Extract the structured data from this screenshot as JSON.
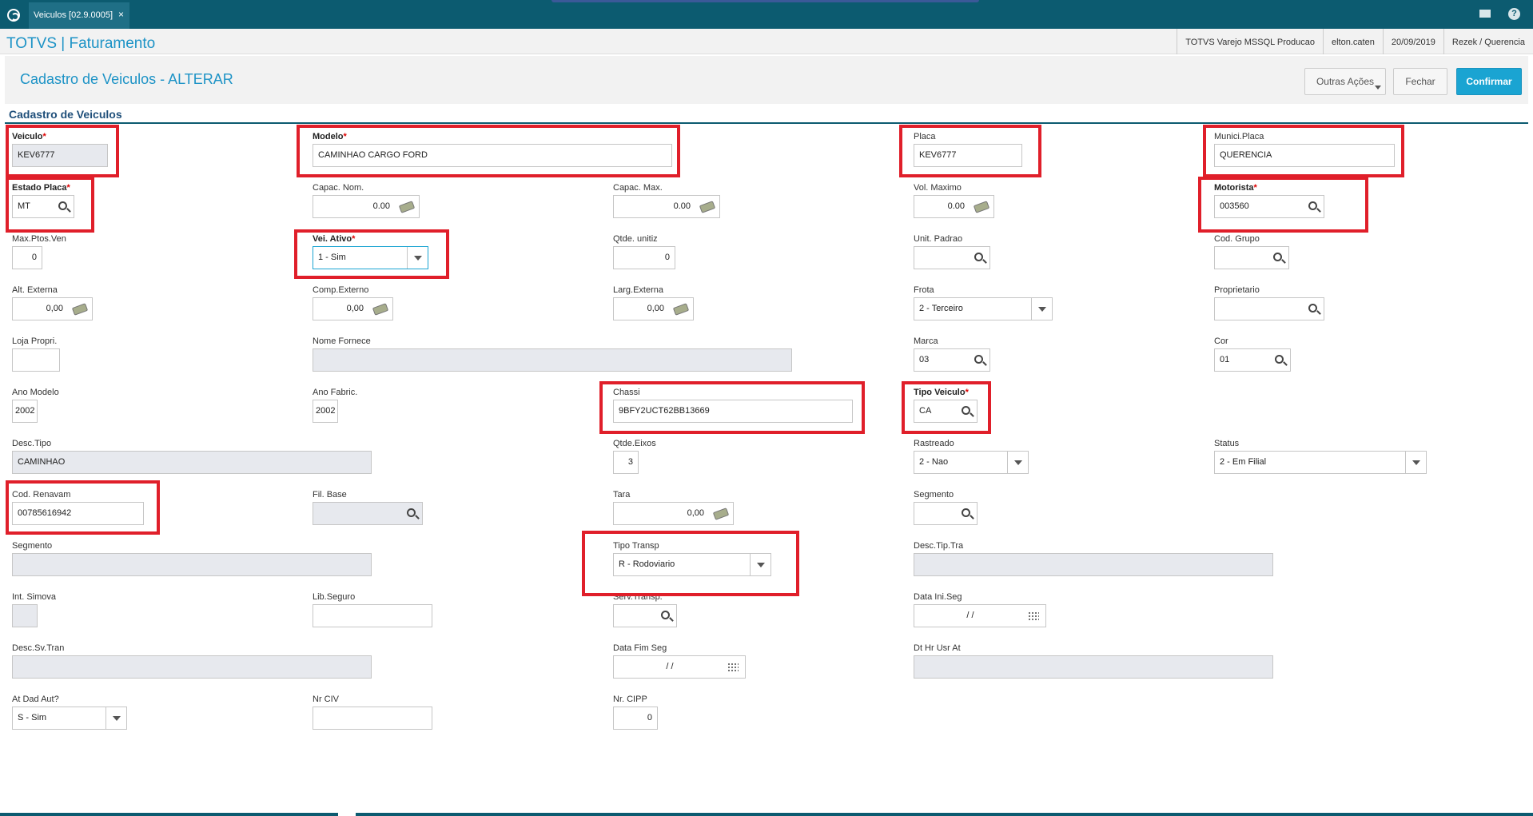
{
  "window": {
    "tab_label": "Veiculos [02.9.0005]",
    "tab_close": "×",
    "help": "?"
  },
  "brand": "TOTVS | Faturamento",
  "info": [
    "TOTVS Varejo MSSQL Producao",
    "elton.caten",
    "20/09/2019",
    "Rezek / Querencia"
  ],
  "page_title": "Cadastro de Veiculos - ALTERAR",
  "buttons": {
    "outras": "Outras Ações",
    "fechar": "Fechar",
    "confirmar": "Confirmar"
  },
  "section_title": "Cadastro de Veiculos",
  "fields": {
    "veiculo": {
      "label": "Veiculo",
      "value": "KEV6777"
    },
    "modelo": {
      "label": "Modelo",
      "value": "CAMINHAO CARGO FORD"
    },
    "placa": {
      "label": "Placa",
      "value": "KEV6777"
    },
    "munici_placa": {
      "label": "Munici.Placa",
      "value": "QUERENCIA"
    },
    "estado_placa": {
      "label": "Estado Placa",
      "value": "MT"
    },
    "capac_nom": {
      "label": "Capac. Nom.",
      "value": "0.00"
    },
    "capac_max": {
      "label": "Capac. Max.",
      "value": "0.00"
    },
    "vol_maximo": {
      "label": "Vol. Maximo",
      "value": "0.00"
    },
    "motorista": {
      "label": "Motorista",
      "value": "003560"
    },
    "max_ptos_ven": {
      "label": "Max.Ptos.Ven",
      "value": "0"
    },
    "vei_ativo": {
      "label": "Vei. Ativo",
      "value": "1 - Sim"
    },
    "qtde_unitiz": {
      "label": "Qtde. unitiz",
      "value": "0"
    },
    "unit_padrao": {
      "label": "Unit. Padrao",
      "value": ""
    },
    "cod_grupo": {
      "label": "Cod. Grupo",
      "value": ""
    },
    "alt_externa": {
      "label": "Alt. Externa",
      "value": "0,00"
    },
    "comp_externo": {
      "label": "Comp.Externo",
      "value": "0,00"
    },
    "larg_externa": {
      "label": "Larg.Externa",
      "value": "0,00"
    },
    "frota": {
      "label": "Frota",
      "value": "2 - Terceiro"
    },
    "proprietario": {
      "label": "Proprietario",
      "value": ""
    },
    "loja_propri": {
      "label": "Loja Propri.",
      "value": ""
    },
    "nome_fornece": {
      "label": "Nome Fornece",
      "value": ""
    },
    "marca": {
      "label": "Marca",
      "value": "03"
    },
    "cor": {
      "label": "Cor",
      "value": "01"
    },
    "ano_modelo": {
      "label": "Ano Modelo",
      "value": "2002"
    },
    "ano_fabric": {
      "label": "Ano Fabric.",
      "value": "2002"
    },
    "chassi": {
      "label": "Chassi",
      "value": "9BFY2UCT62BB13669"
    },
    "tipo_veiculo": {
      "label": "Tipo Veiculo",
      "value": "CA"
    },
    "desc_tipo": {
      "label": "Desc.Tipo",
      "value": "CAMINHAO"
    },
    "qtde_eixos": {
      "label": "Qtde.Eixos",
      "value": "3"
    },
    "rastreado": {
      "label": "Rastreado",
      "value": "2 - Nao"
    },
    "status": {
      "label": "Status",
      "value": "2 - Em Filial"
    },
    "cod_renavam": {
      "label": "Cod. Renavam",
      "value": "00785616942"
    },
    "fil_base": {
      "label": "Fil. Base",
      "value": ""
    },
    "tara": {
      "label": "Tara",
      "value": "0,00"
    },
    "segmento_top": {
      "label": "Segmento",
      "value": ""
    },
    "segmento": {
      "label": "Segmento",
      "value": ""
    },
    "tipo_transp": {
      "label": "Tipo Transp",
      "value": "R - Rodoviario"
    },
    "desc_tip_tra": {
      "label": "Desc.Tip.Tra",
      "value": ""
    },
    "int_simova": {
      "label": "Int. Simova",
      "value": ""
    },
    "lib_seguro": {
      "label": "Lib.Seguro",
      "value": ""
    },
    "serv_transp": {
      "label": "Serv.Transp.",
      "value": ""
    },
    "data_ini_seg": {
      "label": "Data Ini.Seg",
      "value": "/ /"
    },
    "desc_sv_tran": {
      "label": "Desc.Sv.Tran",
      "value": ""
    },
    "data_fim_seg": {
      "label": "Data Fim Seg",
      "value": "/ /"
    },
    "dt_hr_usr_at": {
      "label": "Dt Hr Usr At",
      "value": ""
    },
    "at_dad_aut": {
      "label": "At Dad Aut?",
      "value": "S - Sim"
    },
    "nr_civ": {
      "label": "Nr CIV",
      "value": ""
    },
    "nr_cipp": {
      "label": "Nr. CIPP",
      "value": "0"
    }
  },
  "required_marker": "*",
  "highlight_color": "#e01f2a"
}
